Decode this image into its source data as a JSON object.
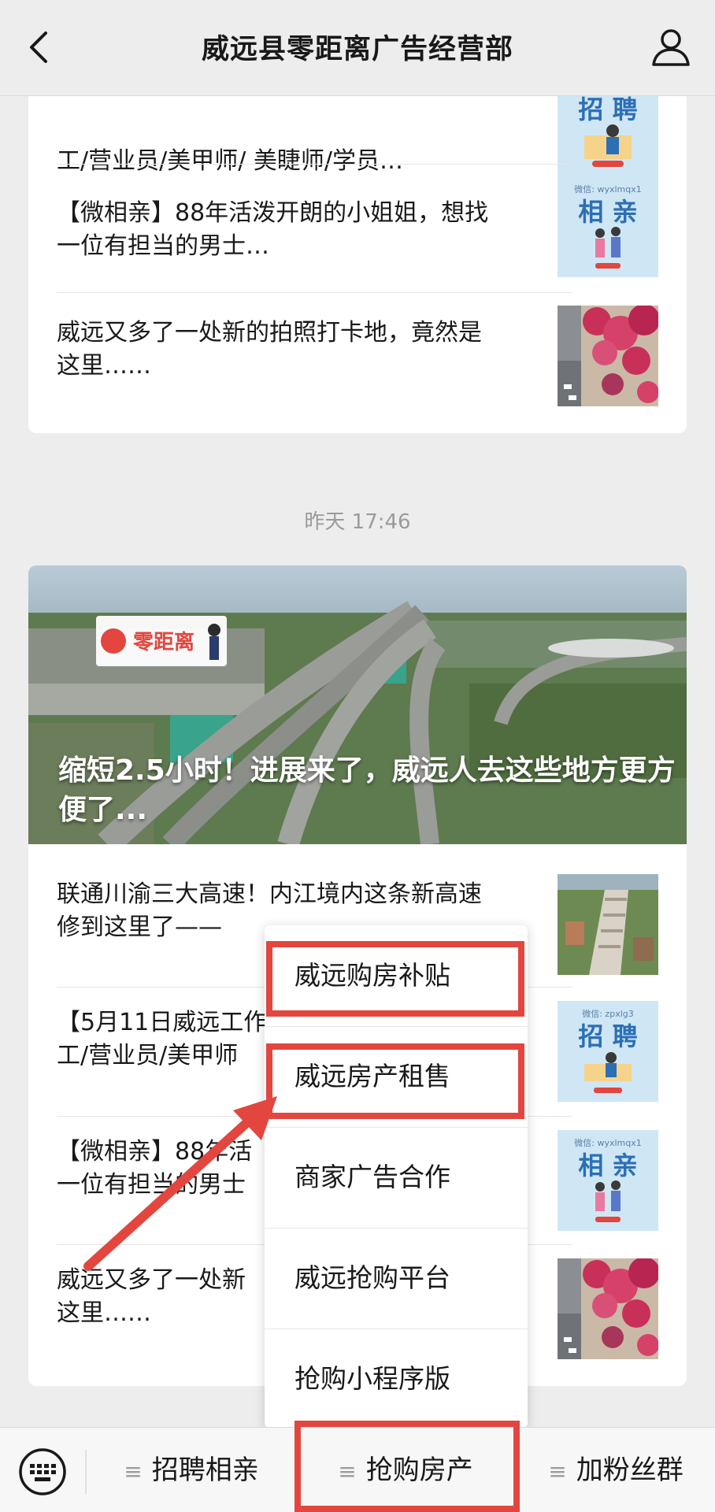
{
  "header": {
    "title": "威远县零距离广告经营部"
  },
  "card1": {
    "items": [
      {
        "text_line1": "工/营业员/美甲师/ 美睫师/学员…",
        "thumb": "zhaopin"
      },
      {
        "text_line1": "【微相亲】88年活泼开朗的小姐姐，想找",
        "text_line2": "一位有担当的男士…",
        "thumb": "xiangqin"
      },
      {
        "text_line1": "威远又多了一处新的拍照打卡地，竟然是",
        "text_line2": "这里……",
        "thumb": "flowers"
      }
    ]
  },
  "timestamp": "昨天 17:46",
  "card2": {
    "banner": {
      "title": "缩短2.5小时！进展来了，威远人去这些地方更方便了...",
      "logo": "零距离"
    },
    "items": [
      {
        "text_line1": "联通川渝三大高速！内江境内这条新高速",
        "text_line2": "修到这里了——",
        "thumb": "building"
      },
      {
        "text_line1": "【5月11日威远工作",
        "text_line2": "工/营业员/美甲师",
        "thumb": "zhaopin"
      },
      {
        "text_line1": "【微相亲】88年活",
        "text_line2": "一位有担当的男士",
        "thumb": "xiangqin"
      },
      {
        "text_line1": "威远又多了一处新",
        "text_line2": "这里……",
        "thumb": "flowers"
      }
    ]
  },
  "thumbs": {
    "zhaopin_wechat": "微信: zpxlg3",
    "zhaopin_label": "招 聘",
    "xiangqin_wechat": "微信: wyxlmqx1",
    "xiangqin_label": "相 亲"
  },
  "menu": {
    "items": [
      "威远购房补贴",
      "威远房产租售",
      "商家广告合作",
      "威远抢购平台",
      "抢购小程序版"
    ]
  },
  "bottom_menu": {
    "items": [
      "招聘相亲",
      "抢购房产",
      "加粉丝群"
    ]
  },
  "colors": {
    "highlight": "#e2463f",
    "background": "#ededed"
  }
}
